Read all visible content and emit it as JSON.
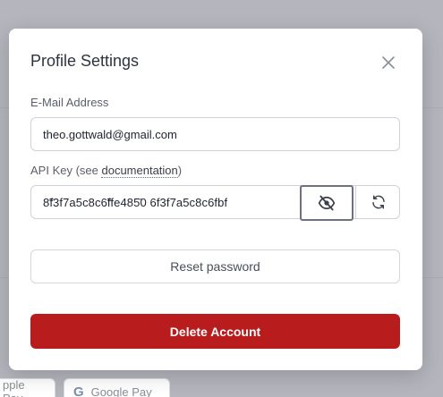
{
  "dialog": {
    "title": "Profile Settings",
    "email": {
      "label": "E-Mail Address",
      "value": "theo.gottwald@gmail.com"
    },
    "api_key": {
      "label_prefix": "API Key (see ",
      "label_link": "documentation",
      "label_suffix": ")",
      "value": "8̃f3f7a5c8c6̃ffe485̆0 6f3f7a5c8c6fbf"
    },
    "reset_password_label": "Reset password",
    "delete_account_label": "Delete Account"
  },
  "background": {
    "apple_pay_label": "pple Pay",
    "google_pay_label": "Google Pay"
  },
  "colors": {
    "danger": "#b91c1c",
    "overlay": "#5a5e6e"
  },
  "icons": [
    "close-icon",
    "eye-off-icon",
    "refresh-icon",
    "google-icon"
  ]
}
